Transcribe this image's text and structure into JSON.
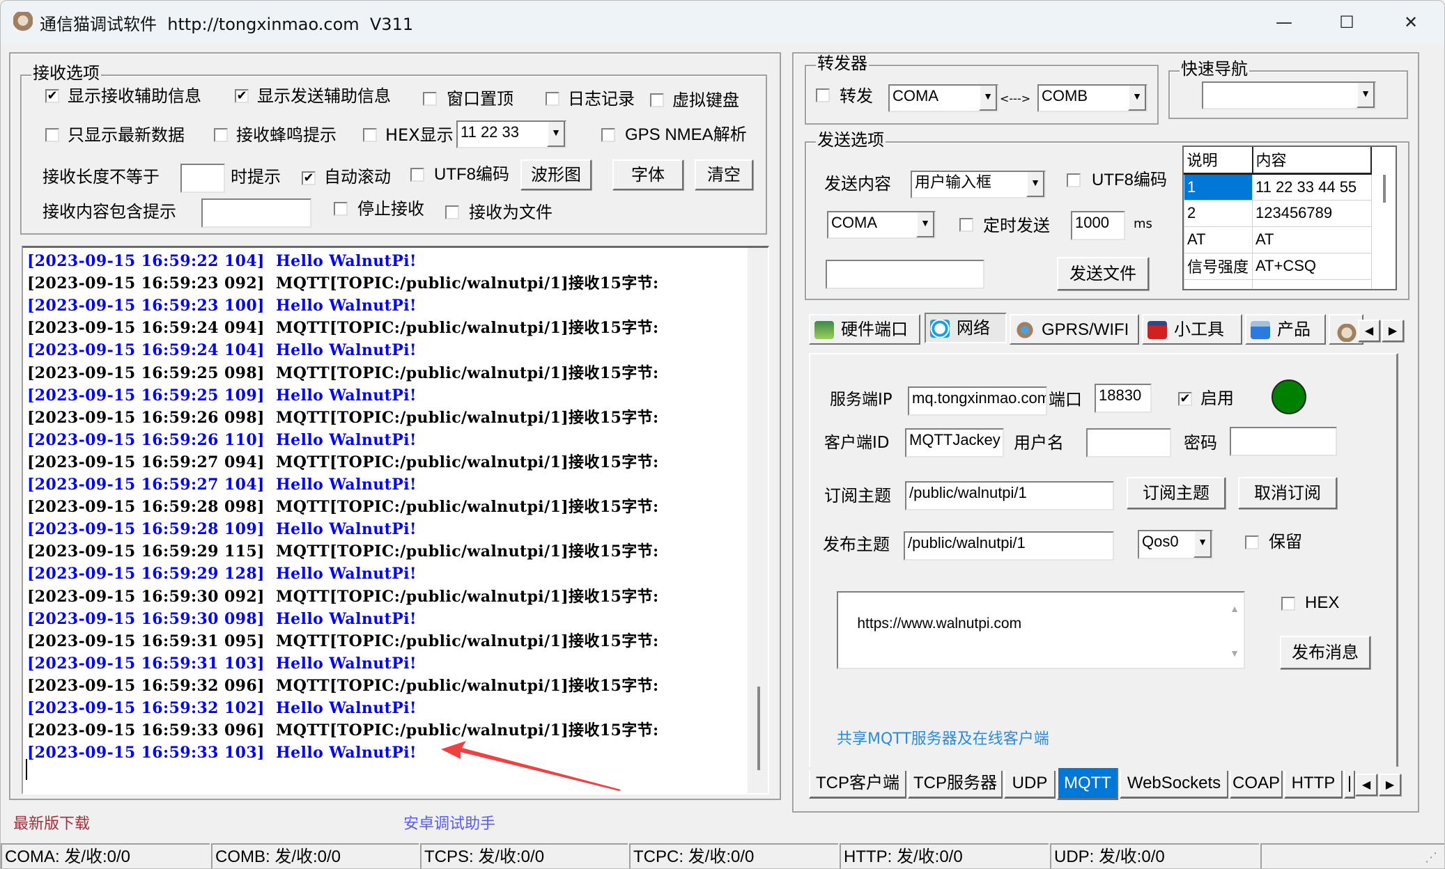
{
  "window": {
    "title": "通信猫调试软件  http://tongxinmao.com  V311",
    "controls": {
      "minimize": "—",
      "maximize": "☐",
      "close": "✕"
    }
  },
  "receive_options": {
    "group_label": "接收选项",
    "show_recv_info": {
      "label": "显示接收辅助信息",
      "checked": true
    },
    "show_send_info": {
      "label": "显示发送辅助信息",
      "checked": true
    },
    "window_topmost": {
      "label": "窗口置顶",
      "checked": false
    },
    "log_record": {
      "label": "日志记录",
      "checked": false
    },
    "virtual_keyboard": {
      "label": "虚拟键盘",
      "checked": false
    },
    "only_latest": {
      "label": "只显示最新数据",
      "checked": false
    },
    "recv_beep": {
      "label": "接收蜂鸣提示",
      "checked": false
    },
    "hex_display": {
      "label": "HEX显示",
      "checked": false
    },
    "hex_sample_select": "11 22 33",
    "gps_nmea": {
      "label": "GPS NMEA解析",
      "checked": false
    },
    "len_not_equal_label": "接收长度不等于",
    "len_not_equal_value": "",
    "len_suffix": "时提示",
    "auto_scroll": {
      "label": "自动滚动",
      "checked": true
    },
    "utf8": {
      "label": "UTF8编码",
      "checked": false
    },
    "waveform_button": "波形图",
    "font_button": "字体",
    "clear_button": "清空",
    "contains_label": "接收内容包含提示",
    "contains_value": "",
    "stop_recv": {
      "label": "停止接收",
      "checked": false
    },
    "recv_to_file": {
      "label": "接收为文件",
      "checked": false
    }
  },
  "log": {
    "colors": {
      "recv": "#000000",
      "send": "#0000ff"
    },
    "lines": [
      {
        "kind": "send",
        "time": "[2023-09-15 16:59:22 104]",
        "text": "Hello WalnutPi!"
      },
      {
        "kind": "recv",
        "time": "[2023-09-15 16:59:23 092]",
        "text": "MQTT[TOPIC:/public/walnutpi/1]接收15字节:"
      },
      {
        "kind": "send",
        "time": "[2023-09-15 16:59:23 100]",
        "text": "Hello WalnutPi!"
      },
      {
        "kind": "recv",
        "time": "[2023-09-15 16:59:24 094]",
        "text": "MQTT[TOPIC:/public/walnutpi/1]接收15字节:"
      },
      {
        "kind": "send",
        "time": "[2023-09-15 16:59:24 104]",
        "text": "Hello WalnutPi!"
      },
      {
        "kind": "recv",
        "time": "[2023-09-15 16:59:25 098]",
        "text": "MQTT[TOPIC:/public/walnutpi/1]接收15字节:"
      },
      {
        "kind": "send",
        "time": "[2023-09-15 16:59:25 109]",
        "text": "Hello WalnutPi!"
      },
      {
        "kind": "recv",
        "time": "[2023-09-15 16:59:26 098]",
        "text": "MQTT[TOPIC:/public/walnutpi/1]接收15字节:"
      },
      {
        "kind": "send",
        "time": "[2023-09-15 16:59:26 110]",
        "text": "Hello WalnutPi!"
      },
      {
        "kind": "recv",
        "time": "[2023-09-15 16:59:27 094]",
        "text": "MQTT[TOPIC:/public/walnutpi/1]接收15字节:"
      },
      {
        "kind": "send",
        "time": "[2023-09-15 16:59:27 104]",
        "text": "Hello WalnutPi!"
      },
      {
        "kind": "recv",
        "time": "[2023-09-15 16:59:28 098]",
        "text": "MQTT[TOPIC:/public/walnutpi/1]接收15字节:"
      },
      {
        "kind": "send",
        "time": "[2023-09-15 16:59:28 109]",
        "text": "Hello WalnutPi!"
      },
      {
        "kind": "recv",
        "time": "[2023-09-15 16:59:29 115]",
        "text": "MQTT[TOPIC:/public/walnutpi/1]接收15字节:"
      },
      {
        "kind": "send",
        "time": "[2023-09-15 16:59:29 128]",
        "text": "Hello WalnutPi!"
      },
      {
        "kind": "recv",
        "time": "[2023-09-15 16:59:30 092]",
        "text": "MQTT[TOPIC:/public/walnutpi/1]接收15字节:"
      },
      {
        "kind": "send",
        "time": "[2023-09-15 16:59:30 098]",
        "text": "Hello WalnutPi!"
      },
      {
        "kind": "recv",
        "time": "[2023-09-15 16:59:31 095]",
        "text": "MQTT[TOPIC:/public/walnutpi/1]接收15字节:"
      },
      {
        "kind": "send",
        "time": "[2023-09-15 16:59:31 103]",
        "text": "Hello WalnutPi!"
      },
      {
        "kind": "recv",
        "time": "[2023-09-15 16:59:32 096]",
        "text": "MQTT[TOPIC:/public/walnutpi/1]接收15字节:"
      },
      {
        "kind": "send",
        "time": "[2023-09-15 16:59:32 102]",
        "text": "Hello WalnutPi!"
      },
      {
        "kind": "recv",
        "time": "[2023-09-15 16:59:33 096]",
        "text": "MQTT[TOPIC:/public/walnutpi/1]接收15字节:"
      },
      {
        "kind": "send",
        "time": "[2023-09-15 16:59:33 103]",
        "text": "Hello WalnutPi!"
      }
    ]
  },
  "footer_links": {
    "download": "最新版下载",
    "android": "安卓调试助手"
  },
  "forwarder": {
    "group_label": "转发器",
    "forward": {
      "label": "转发",
      "checked": false
    },
    "port_a": "COMA",
    "arrow": "<--->",
    "port_b": "COMB"
  },
  "quick_nav": {
    "group_label": "快速导航",
    "value": ""
  },
  "send_options": {
    "group_label": "发送选项",
    "content_label": "发送内容",
    "content_select": "用户输入框",
    "utf8": {
      "label": "UTF8编码",
      "checked": false
    },
    "port_select": "COMA",
    "timed_send": {
      "label": "定时发送",
      "checked": false
    },
    "interval": "1000",
    "interval_unit": "ms",
    "file_path": "",
    "send_file_button": "发送文件",
    "table": {
      "headers": [
        "说明",
        "内容"
      ],
      "rows": [
        [
          "1",
          "11 22 33 44 55"
        ],
        [
          "2",
          "123456789"
        ],
        [
          "AT",
          "AT"
        ],
        [
          "信号强度",
          "AT+CSQ"
        ],
        [
          "",
          ""
        ]
      ],
      "selected_row": 0
    }
  },
  "top_tabs": [
    {
      "label": "硬件端口",
      "icon": "hardware-card-icon",
      "active": false
    },
    {
      "label": "网络",
      "icon": "network-icon",
      "active": true
    },
    {
      "label": "GPRS/WIFI",
      "icon": "wireless-icon",
      "active": false
    },
    {
      "label": "小工具",
      "icon": "toolbox-icon",
      "active": false
    },
    {
      "label": "产品",
      "icon": "usb-product-icon",
      "active": false
    }
  ],
  "mqtt": {
    "server_ip_label": "服务端IP",
    "server_ip": "mq.tongxinmao.com",
    "port_label": "端口",
    "port": "18830",
    "enable": {
      "label": "启用",
      "checked": true
    },
    "status_color": "#008000",
    "client_id_label": "客户端ID",
    "client_id": "MQTTJackey",
    "username_label": "用户名",
    "username": "",
    "password_label": "密码",
    "password": "",
    "subscribe_topic_label": "订阅主题",
    "subscribe_topic": "/public/walnutpi/1",
    "subscribe_button": "订阅主题",
    "unsubscribe_button": "取消订阅",
    "publish_topic_label": "发布主题",
    "publish_topic": "/public/walnutpi/1",
    "qos": "Qos0",
    "retain": {
      "label": "保留",
      "checked": false
    },
    "message": "https://www.walnutpi.com",
    "hex": {
      "label": "HEX",
      "checked": false
    },
    "publish_button": "发布消息",
    "shared_link": "共享MQTT服务器及在线客户端"
  },
  "bottom_tabs": [
    {
      "label": "TCP客户端",
      "active": false
    },
    {
      "label": "TCP服务器",
      "active": false
    },
    {
      "label": "UDP",
      "active": false
    },
    {
      "label": "MQTT",
      "active": true
    },
    {
      "label": "WebSockets",
      "active": false
    },
    {
      "label": "COAP",
      "active": false
    },
    {
      "label": "HTTP",
      "active": false
    },
    {
      "label": "|",
      "active": false
    }
  ],
  "status_bar": [
    "COMA: 发/收:0/0",
    "COMB: 发/收:0/0",
    "TCPS: 发/收:0/0",
    "TCPC: 发/收:0/0",
    "HTTP: 发/收:0/0",
    "UDP: 发/收:0/0",
    ""
  ],
  "colors": {
    "accent": "#0078d7",
    "log_send": "#0000ff",
    "download_link": "#a0303a",
    "android_link": "#5a5aff",
    "shared_link": "#2a8be0",
    "annotation_arrow": "#f04040"
  }
}
